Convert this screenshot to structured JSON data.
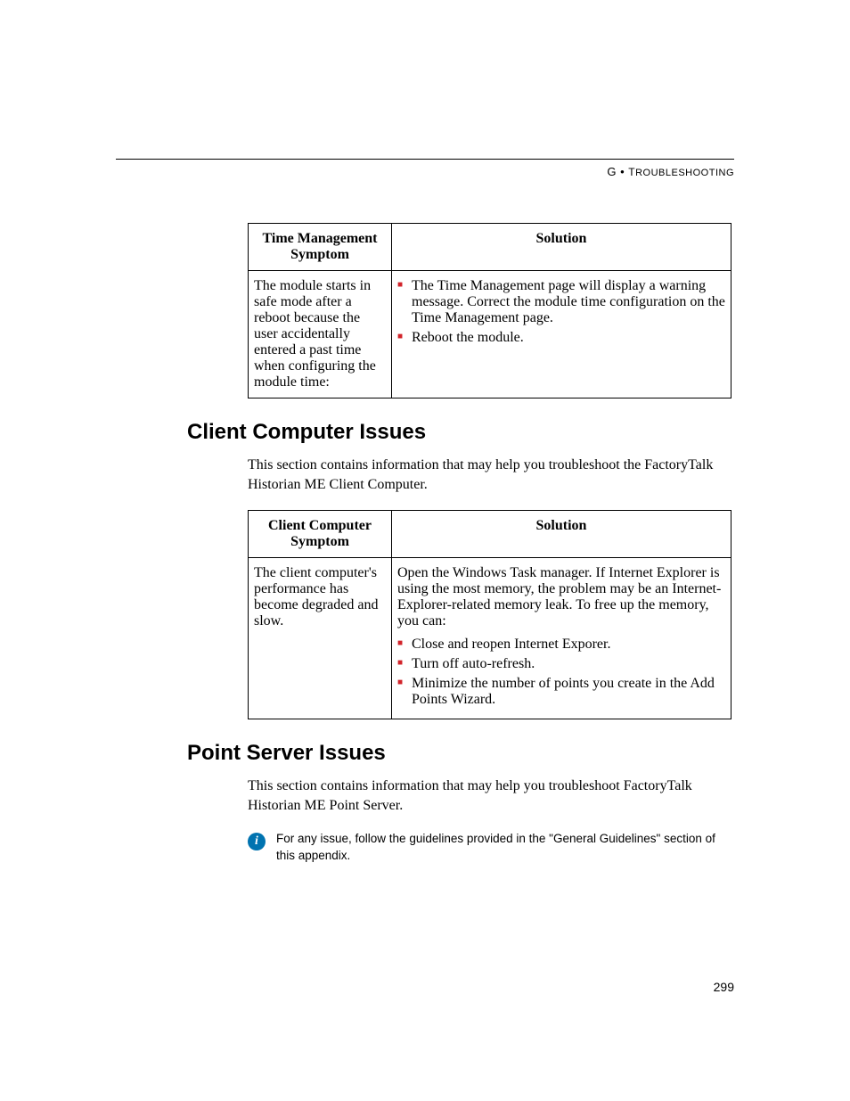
{
  "header": {
    "appendix": "G",
    "separator": "•",
    "title": "Troubleshooting"
  },
  "table1": {
    "head_symptom": "Time Management Symptom",
    "head_solution": "Solution",
    "row_symptom": "The module starts in safe mode after a reboot because the user accidentally entered a past time when configuring the module time:",
    "sol_bullet1": "The Time Management page will display a warning message. Correct the module time configuration on the Time Management page.",
    "sol_bullet2": "Reboot the module."
  },
  "section1": {
    "heading": "Client Computer Issues",
    "intro": "This section contains information that may help you troubleshoot the FactoryTalk Historian ME Client Computer."
  },
  "table2": {
    "head_symptom": "Client Computer Symptom",
    "head_solution": "Solution",
    "row_symptom": "The client computer's performance has become degraded and slow.",
    "sol_intro": "Open the Windows Task manager. If Internet Explorer is using the most memory, the problem may be an Internet-Explorer-related memory leak. To free up the memory, you can:",
    "sol_bullet1": "Close and reopen Internet Exporer.",
    "sol_bullet2": "Turn off auto-refresh.",
    "sol_bullet3": "Minimize the number of points you create in the Add Points Wizard."
  },
  "section2": {
    "heading": "Point Server Issues",
    "intro": "This section contains information that may help you troubleshoot FactoryTalk Historian ME Point Server.",
    "note": "For any issue, follow the guidelines provided in the \"General Guidelines\" section of this appendix."
  },
  "page_number": "299"
}
